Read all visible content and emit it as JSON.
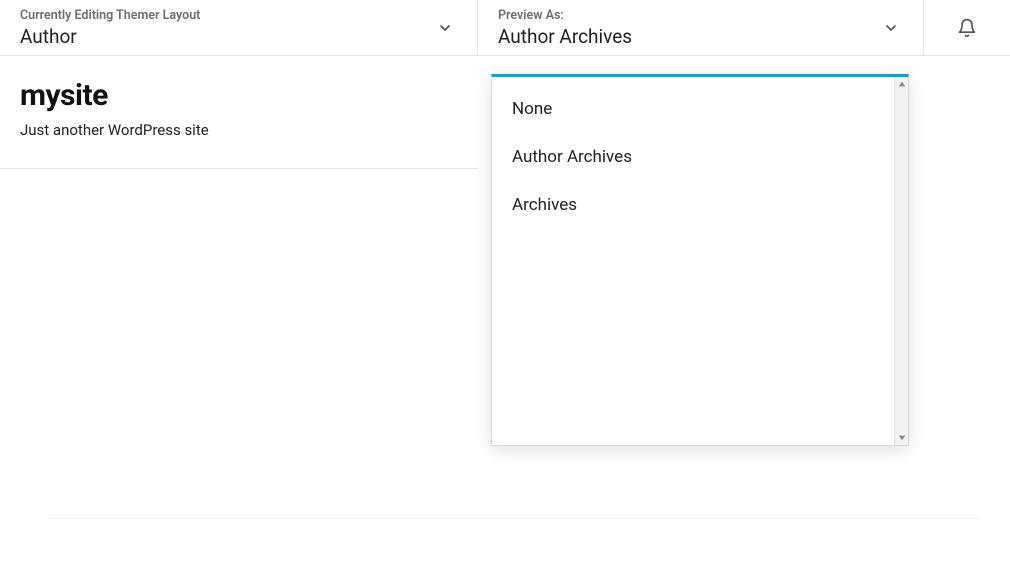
{
  "topbar": {
    "layout": {
      "label": "Currently Editing Themer Layout",
      "value": "Author"
    },
    "preview": {
      "label": "Preview As:",
      "value": "Author Archives"
    }
  },
  "site": {
    "title": "mysite",
    "tagline": "Just another WordPress site"
  },
  "dropdown": {
    "items": [
      {
        "label": "None"
      },
      {
        "label": "Author Archives"
      },
      {
        "label": "Archives"
      }
    ]
  }
}
